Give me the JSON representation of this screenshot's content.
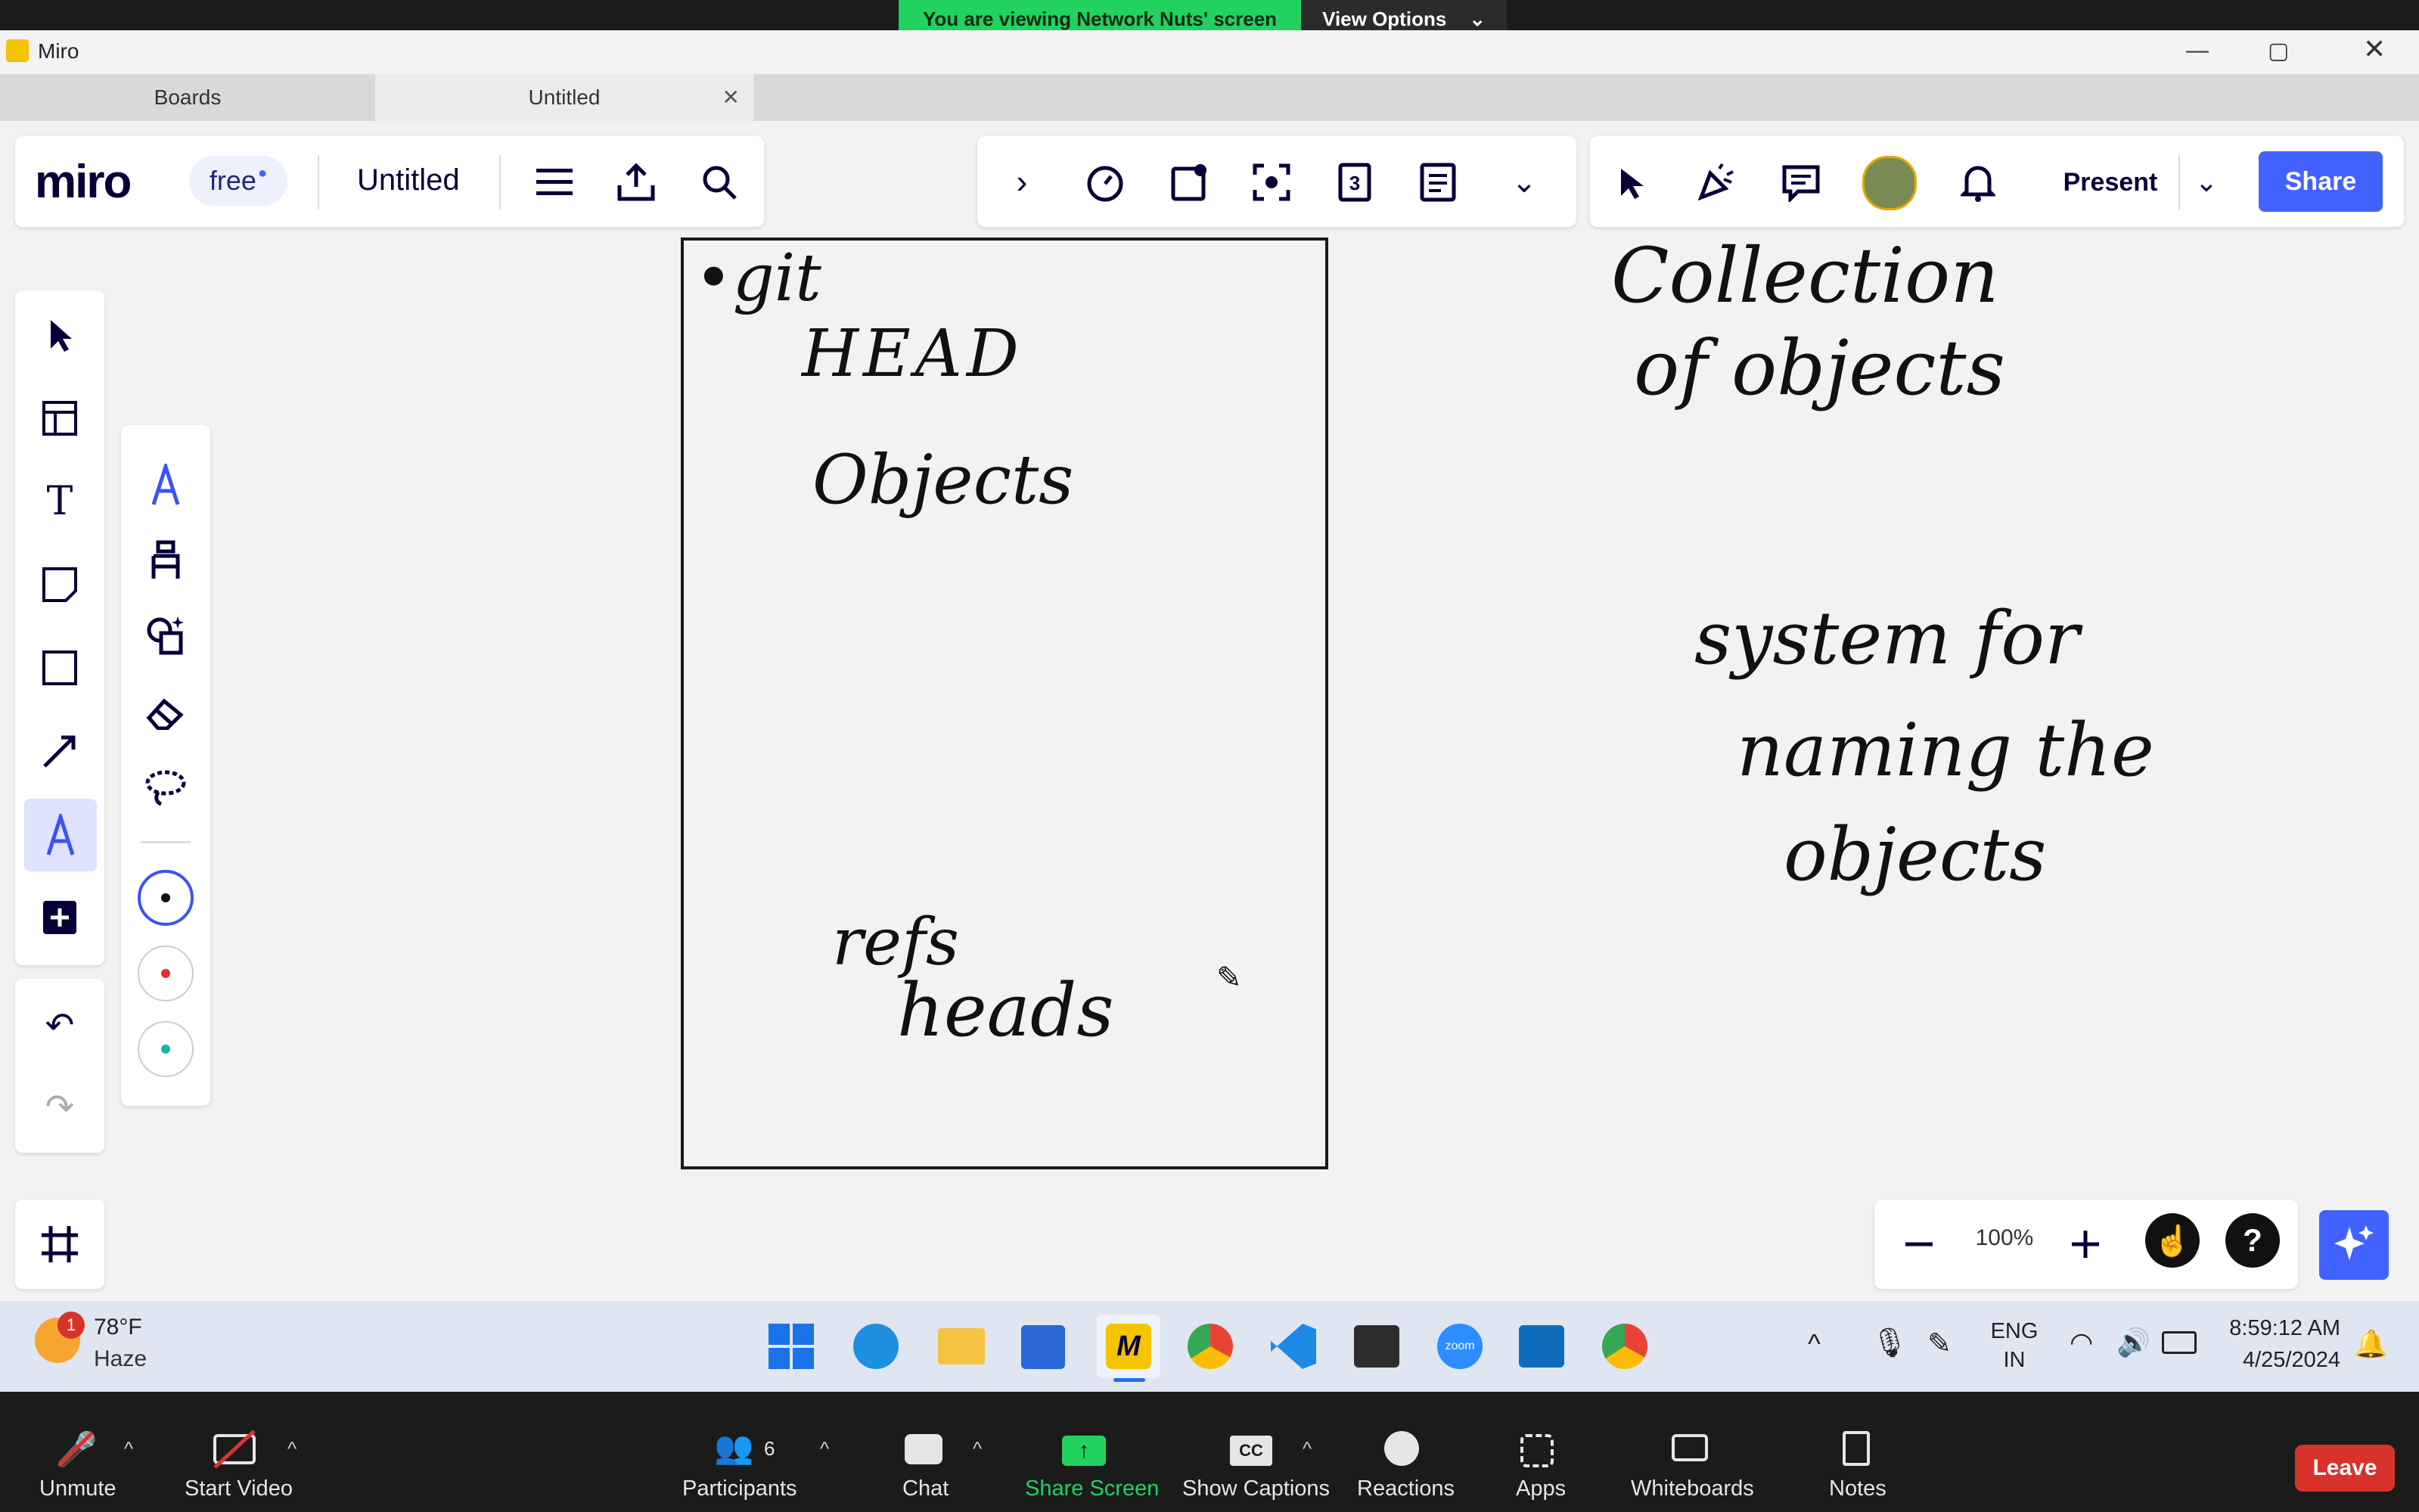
{
  "zoom_share": {
    "banner": "You are viewing Network Nuts' screen",
    "view_options": "View Options"
  },
  "window": {
    "app_title": "Miro",
    "tabs": [
      "Boards",
      "Untitled"
    ]
  },
  "miro_header": {
    "logo": "miro",
    "plan": "free",
    "board_name": "Untitled",
    "present_label": "Present",
    "share_label": "Share",
    "timer_count": "3"
  },
  "board": {
    "frame_notes": {
      "git": "•git",
      "head": "HEAD",
      "objects": "Objects",
      "refs": "refs",
      "heads": "heads"
    },
    "side_notes": {
      "line1": "Collection",
      "line2": "of objects",
      "line3": "system for",
      "line4": "naming the",
      "line5": "objects"
    }
  },
  "zoom_control": {
    "level": "100%"
  },
  "pen_colors": [
    "#3b53f5",
    "#e0302a",
    "#1bb3a8"
  ],
  "taskbar": {
    "weather_temp": "78°F",
    "weather_desc": "Haze",
    "weather_badge": "1",
    "lang1": "ENG",
    "lang2": "IN",
    "time": "8:59:12 AM",
    "date": "4/25/2024"
  },
  "zoom_meeting": {
    "unmute": "Unmute",
    "start_video": "Start Video",
    "participants": "Participants",
    "participants_count": "6",
    "chat": "Chat",
    "share_screen": "Share Screen",
    "captions": "Show Captions",
    "reactions": "Reactions",
    "apps": "Apps",
    "whiteboards": "Whiteboards",
    "notes": "Notes",
    "leave": "Leave"
  }
}
